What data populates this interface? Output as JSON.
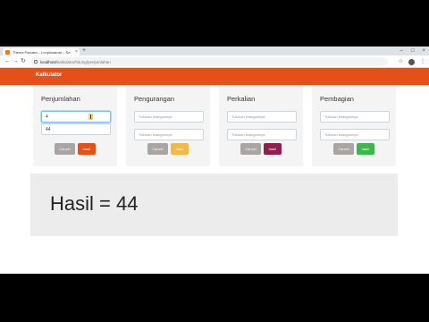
{
  "browser": {
    "tab_title": "Thema Parcara – Loopiozamar – Sa",
    "url_host": "localhost",
    "url_path": "/kalkulator/hitung/penjumlahan"
  },
  "app": {
    "brand": "Kalkulator"
  },
  "cards": [
    {
      "title": "Penjumlahan",
      "input1_value": "4",
      "input2_value": "44",
      "cancel_label": "Cancel",
      "hasil_label": "hasil",
      "hasil_color": "#e4501a"
    },
    {
      "title": "Pengurangan",
      "input1_placeholder": "Tuliskan bilangannya",
      "input2_placeholder": "Tuliskan bilangannya",
      "cancel_label": "Cancel",
      "hasil_label": "hasil",
      "hasil_color": "#f0b94a"
    },
    {
      "title": "Perkalian",
      "input1_placeholder": "Tuliskan bilangannya",
      "input2_placeholder": "Tuliskan bilangannya",
      "cancel_label": "Cancel",
      "hasil_label": "hasil",
      "hasil_color": "#8e1f4e"
    },
    {
      "title": "Pembagian",
      "input1_placeholder": "Tuliskan bilangannya",
      "input2_placeholder": "Tuliskan bilangannya",
      "cancel_label": "Cancel",
      "hasil_label": "hasil",
      "hasil_color": "#3fb54e"
    }
  ],
  "result": {
    "text": "Hasil = 44"
  }
}
